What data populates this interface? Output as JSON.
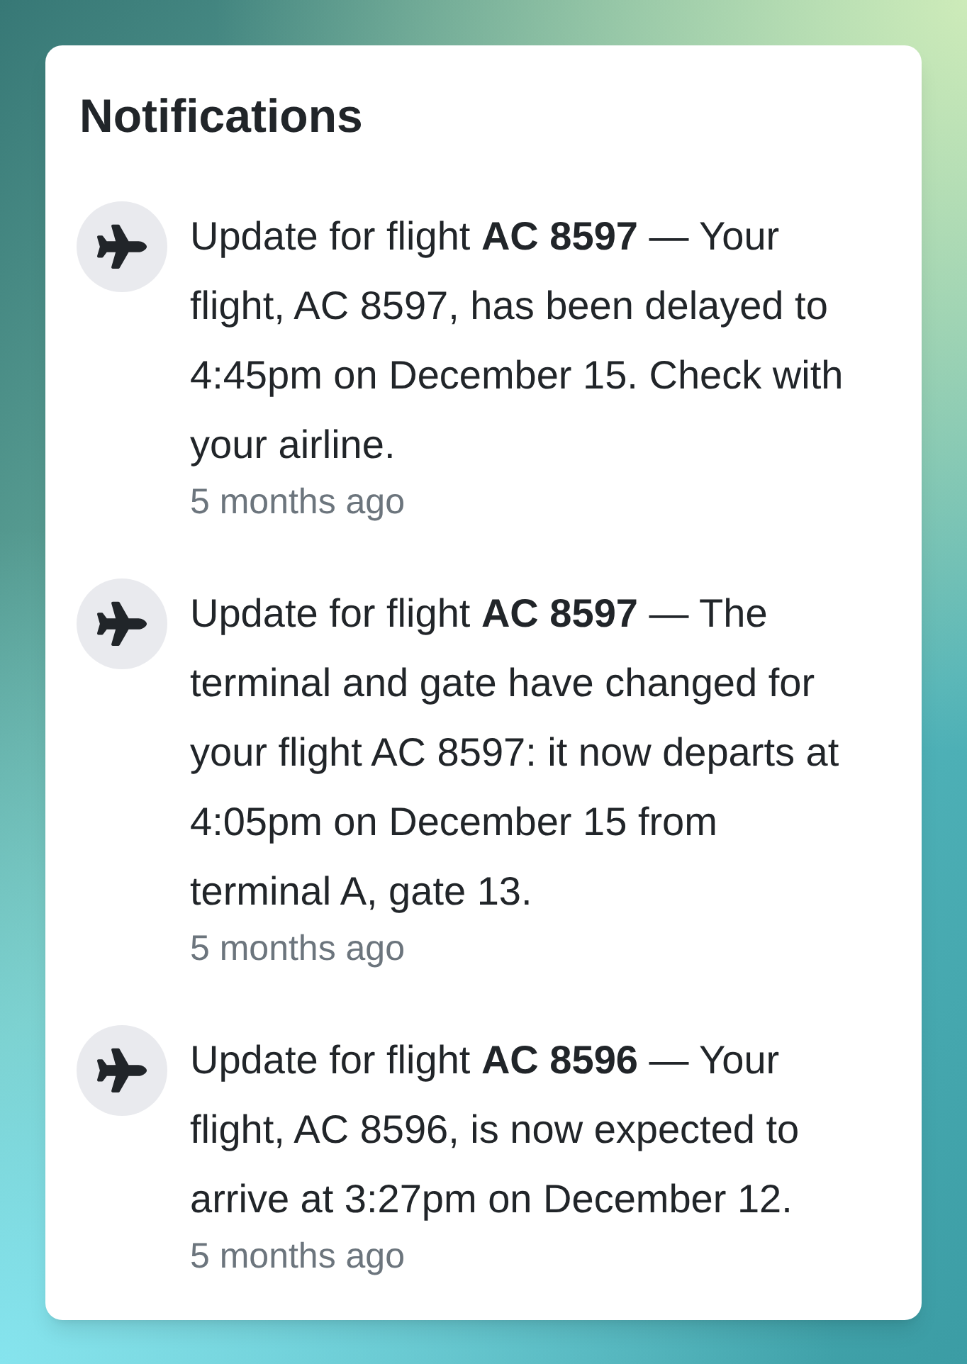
{
  "panel": {
    "title": "Notifications"
  },
  "notifications": [
    {
      "text": "Update for flight **AC 8597** — Your flight, AC 8597, has been delayed to 4:45pm on December 15. Check with your airline.",
      "time": "5 months ago"
    },
    {
      "text": "Update for flight **AC 8597** — The terminal and gate have changed for your flight AC 8597: it now departs at 4:05pm on December 15 from terminal A, gate 13.",
      "time": "5 months ago"
    },
    {
      "text": "Update for flight **AC 8596** — Your flight, AC 8596, is now expected to arrive at 3:27pm on December 12.",
      "time": "5 months ago"
    }
  ]
}
